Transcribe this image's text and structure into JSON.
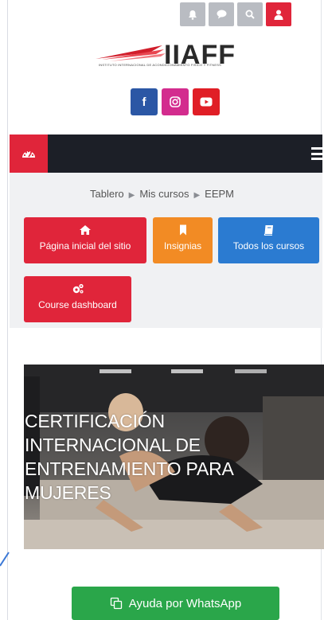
{
  "topbar": {
    "icons": [
      "bell-icon",
      "chat-icon",
      "search-icon",
      "user-icon"
    ]
  },
  "logo": {
    "wordmark": "IIAFF",
    "tagline": "INSTITUTO INTERNACIONAL DE ACONDICIONAMIENTO FISICO Y FITNESS"
  },
  "social": {
    "facebook": "f"
  },
  "breadcrumb": {
    "items": [
      "Tablero",
      "Mis cursos",
      "EEPM"
    ]
  },
  "quick_links": {
    "home": "Página inicial del sitio",
    "badges": "Insignias",
    "courses": "Todos los cursos",
    "dashboard": "Course dashboard"
  },
  "banner": {
    "lines": [
      "CERTIFICACIÓN",
      "INTERNACIONAL DE",
      "ENTRENAMIENTO PARA",
      "MUJERES"
    ]
  },
  "whatsapp": {
    "label": "Ayuda por WhatsApp"
  },
  "colors": {
    "red": "#e0253a",
    "orange": "#f28b24",
    "blue": "#2b7bd1",
    "green": "#2aa64a",
    "nav": "#1c1f27"
  }
}
